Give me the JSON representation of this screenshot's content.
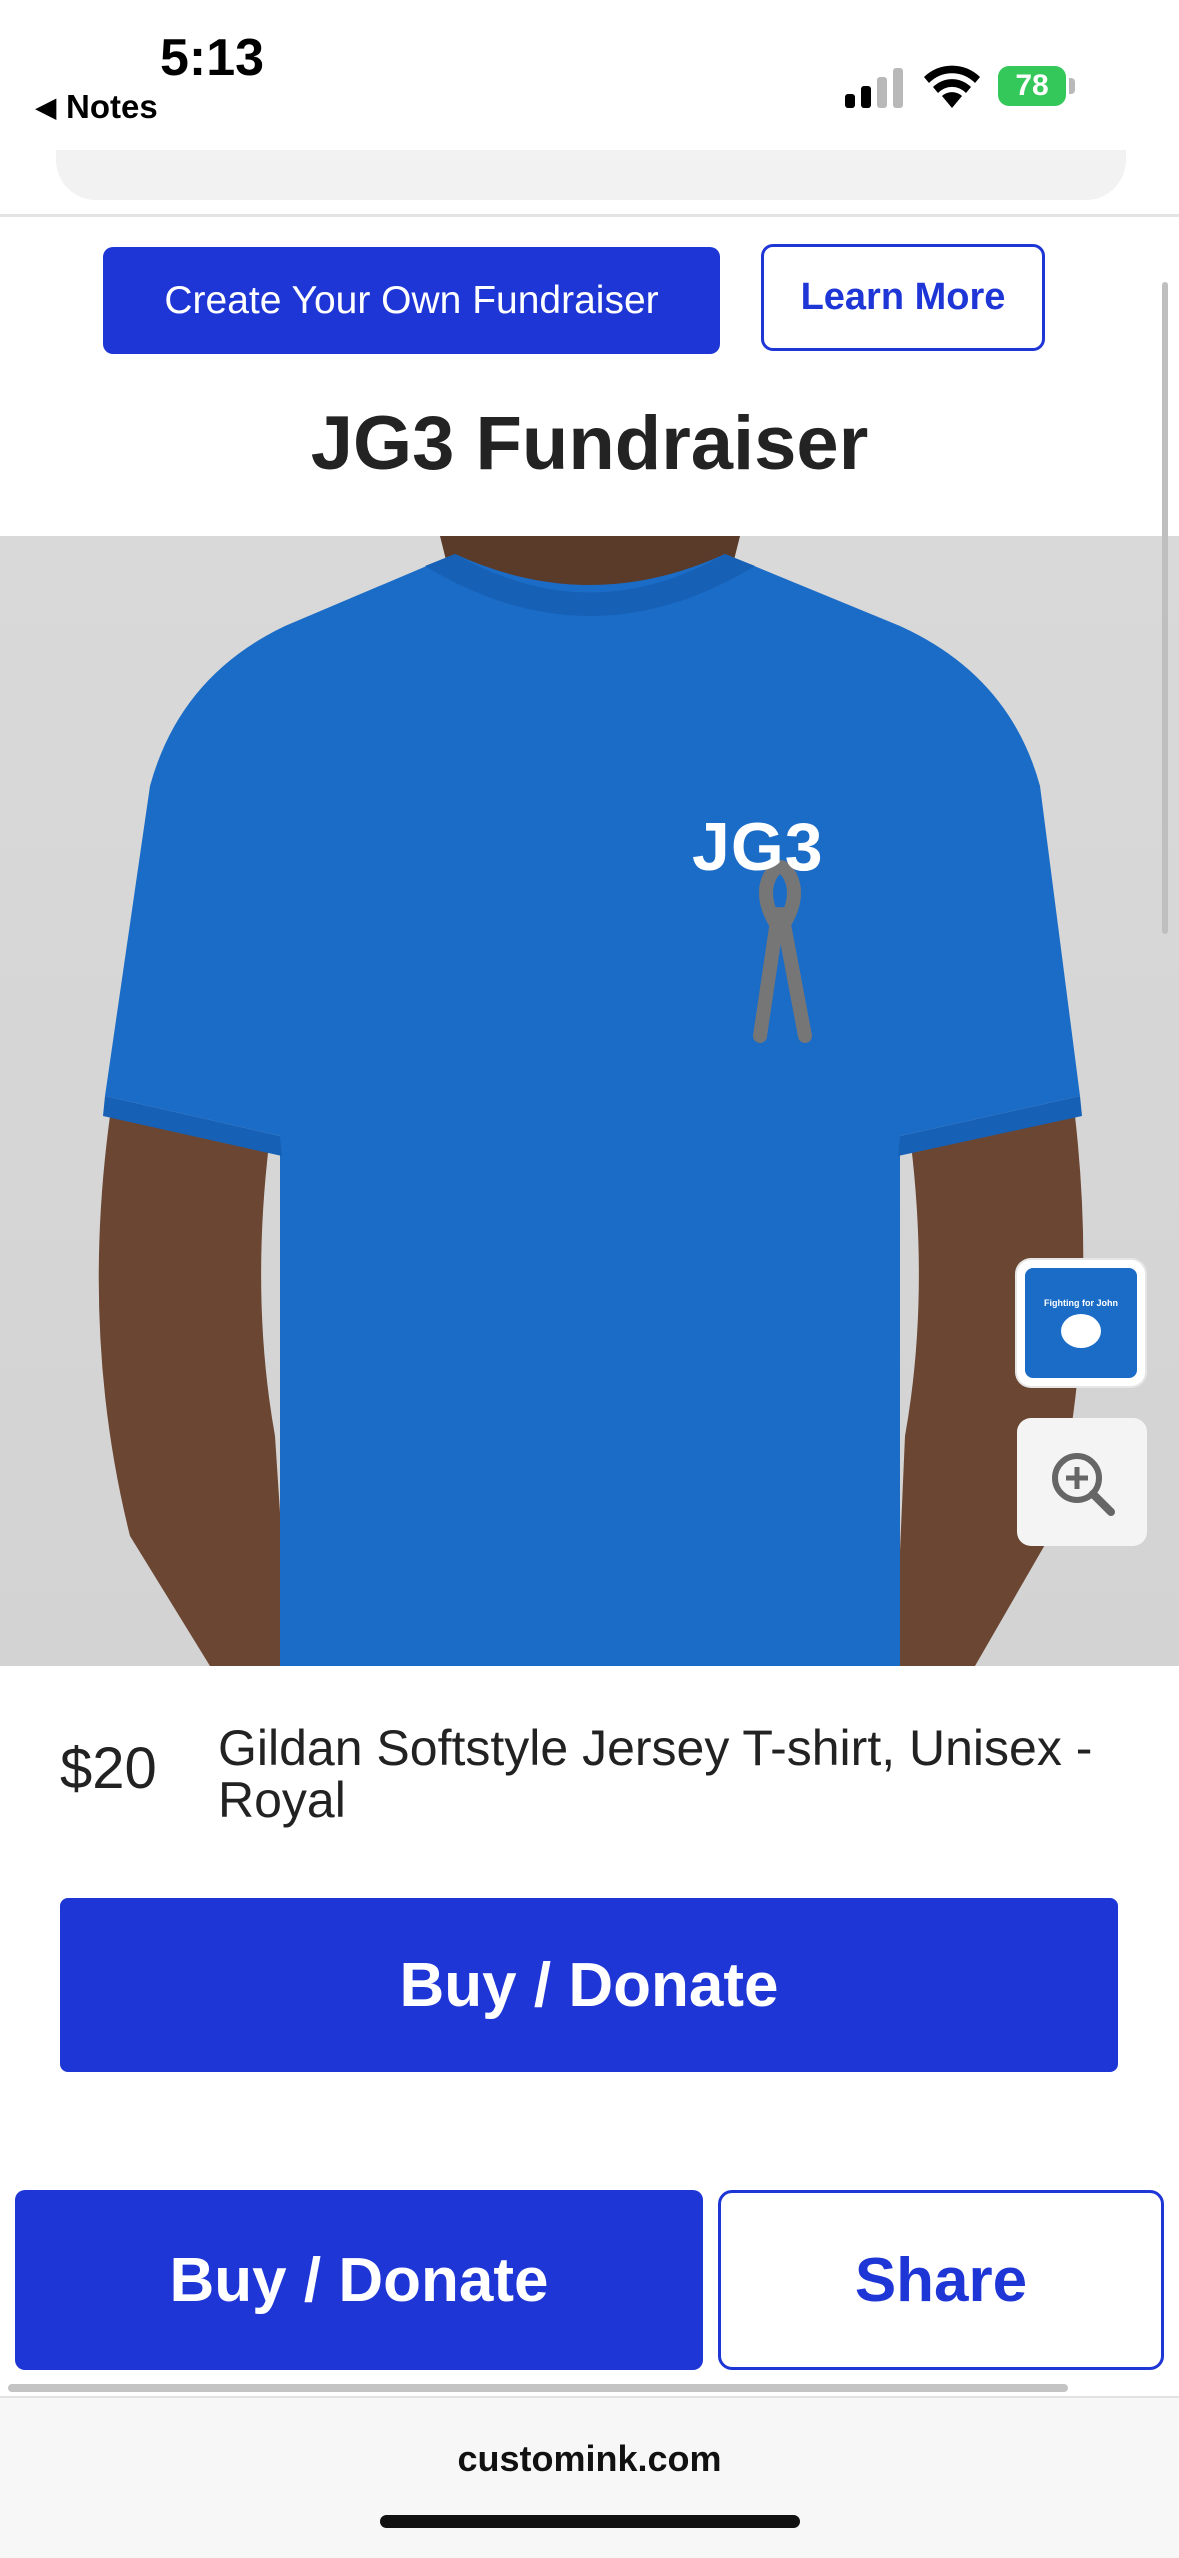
{
  "status_bar": {
    "time": "5:13",
    "back_app": "Notes",
    "battery": "78"
  },
  "header": {
    "create_button": "Create Your Own Fundraiser",
    "learn_button": "Learn More",
    "title": "JG3 Fundraiser"
  },
  "product": {
    "shirt_print": "JG3",
    "thumbnail_text": "Fighting for John",
    "price": "$20",
    "description": "Gildan Softstyle Jersey T-shirt, Unisex - Royal",
    "buy_button": "Buy / Donate",
    "colors": {
      "shirt": "#1b6cc7",
      "accent": "#1f36d6"
    }
  },
  "bottom_bar": {
    "buy_button": "Buy / Donate",
    "share_button": "Share"
  },
  "browser": {
    "url": "customink.com"
  },
  "icons": [
    "back-arrow-icon",
    "signal-icon",
    "wifi-icon",
    "battery-icon",
    "zoom-in-icon",
    "ribbon-icon"
  ]
}
